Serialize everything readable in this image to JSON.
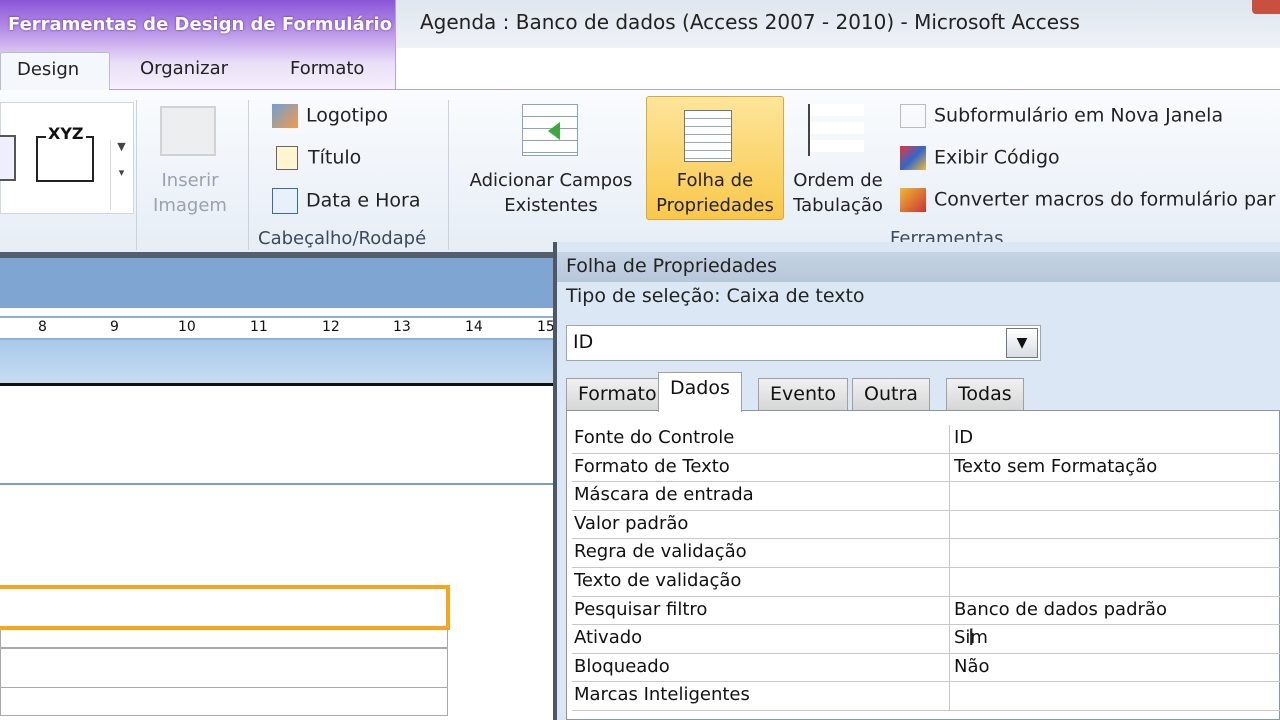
{
  "window": {
    "title": "Agenda : Banco de dados (Access 2007 - 2010)  -  Microsoft Access",
    "context_label": "Ferramentas de Design de Formulário"
  },
  "tabs": [
    {
      "label": "Design"
    },
    {
      "label": "Organizar"
    },
    {
      "label": "Formato"
    }
  ],
  "ribbon": {
    "controls_gallery_label": "XYZ",
    "insert_image": [
      "Inserir",
      "Imagem"
    ],
    "header_footer": {
      "logo": "Logotipo",
      "title": "Título",
      "datetime": "Data e Hora",
      "group": "Cabeçalho/Rodapé"
    },
    "add_fields": [
      "Adicionar Campos",
      "Existentes"
    ],
    "property_sheet": [
      "Folha de",
      "Propriedades"
    ],
    "tab_order": [
      "Ordem de",
      "Tabulação"
    ],
    "tools": {
      "subform": "Subformulário em Nova Janela",
      "view_code": "Exibir Código",
      "convert_macros": "Converter macros do formulário par",
      "group": "Ferramentas"
    }
  },
  "ruler": [
    "8",
    "9",
    "10",
    "11",
    "12",
    "13",
    "14",
    "15"
  ],
  "property_sheet": {
    "title": "Folha de Propriedades",
    "selection_type": "Tipo de seleção:  Caixa de texto",
    "selected_object": "ID",
    "tabs": [
      "Formato",
      "Dados",
      "Evento",
      "Outra",
      "Todas"
    ],
    "active_tab": "Dados",
    "rows": [
      {
        "label": "Fonte do Controle",
        "value": "ID"
      },
      {
        "label": "Formato de Texto",
        "value": "Texto sem Formatação"
      },
      {
        "label": "Máscara de entrada",
        "value": ""
      },
      {
        "label": "Valor padrão",
        "value": ""
      },
      {
        "label": "Regra de validação",
        "value": ""
      },
      {
        "label": "Texto de validação",
        "value": ""
      },
      {
        "label": "Pesquisar filtro",
        "value": "Banco de dados padrão"
      },
      {
        "label": "Ativado",
        "value": "Sim"
      },
      {
        "label": "Bloqueado",
        "value": "Não"
      },
      {
        "label": "Marcas Inteligentes",
        "value": ""
      }
    ]
  },
  "colors": {
    "accent": "#f7a51c",
    "context": "#8a55d8",
    "active_button": "#fbd46a"
  }
}
